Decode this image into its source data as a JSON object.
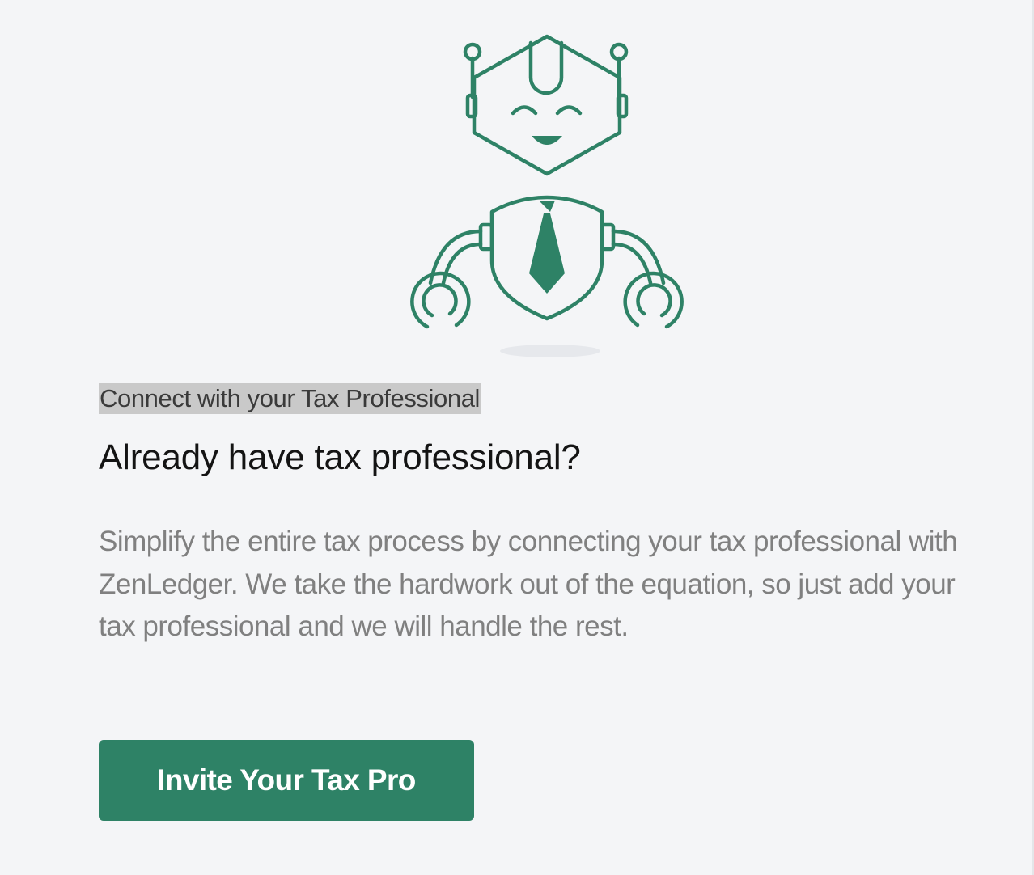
{
  "illustration": {
    "icon": "robot-tax-pro-illustration",
    "accent_color": "#2e8266"
  },
  "card": {
    "eyebrow": "Connect with your Tax Professional",
    "heading": "Already have tax professional?",
    "description": "Simplify the entire tax process by connecting your tax professional with ZenLedger. We take the hardwork out of the equation, so just add your tax professional and we will handle the rest.",
    "cta_label": "Invite Your Tax Pro"
  },
  "colors": {
    "background": "#f4f5f7",
    "primary_button": "#2e8266",
    "eyebrow_highlight": "#c9c9c9",
    "body_text": "#808080"
  }
}
